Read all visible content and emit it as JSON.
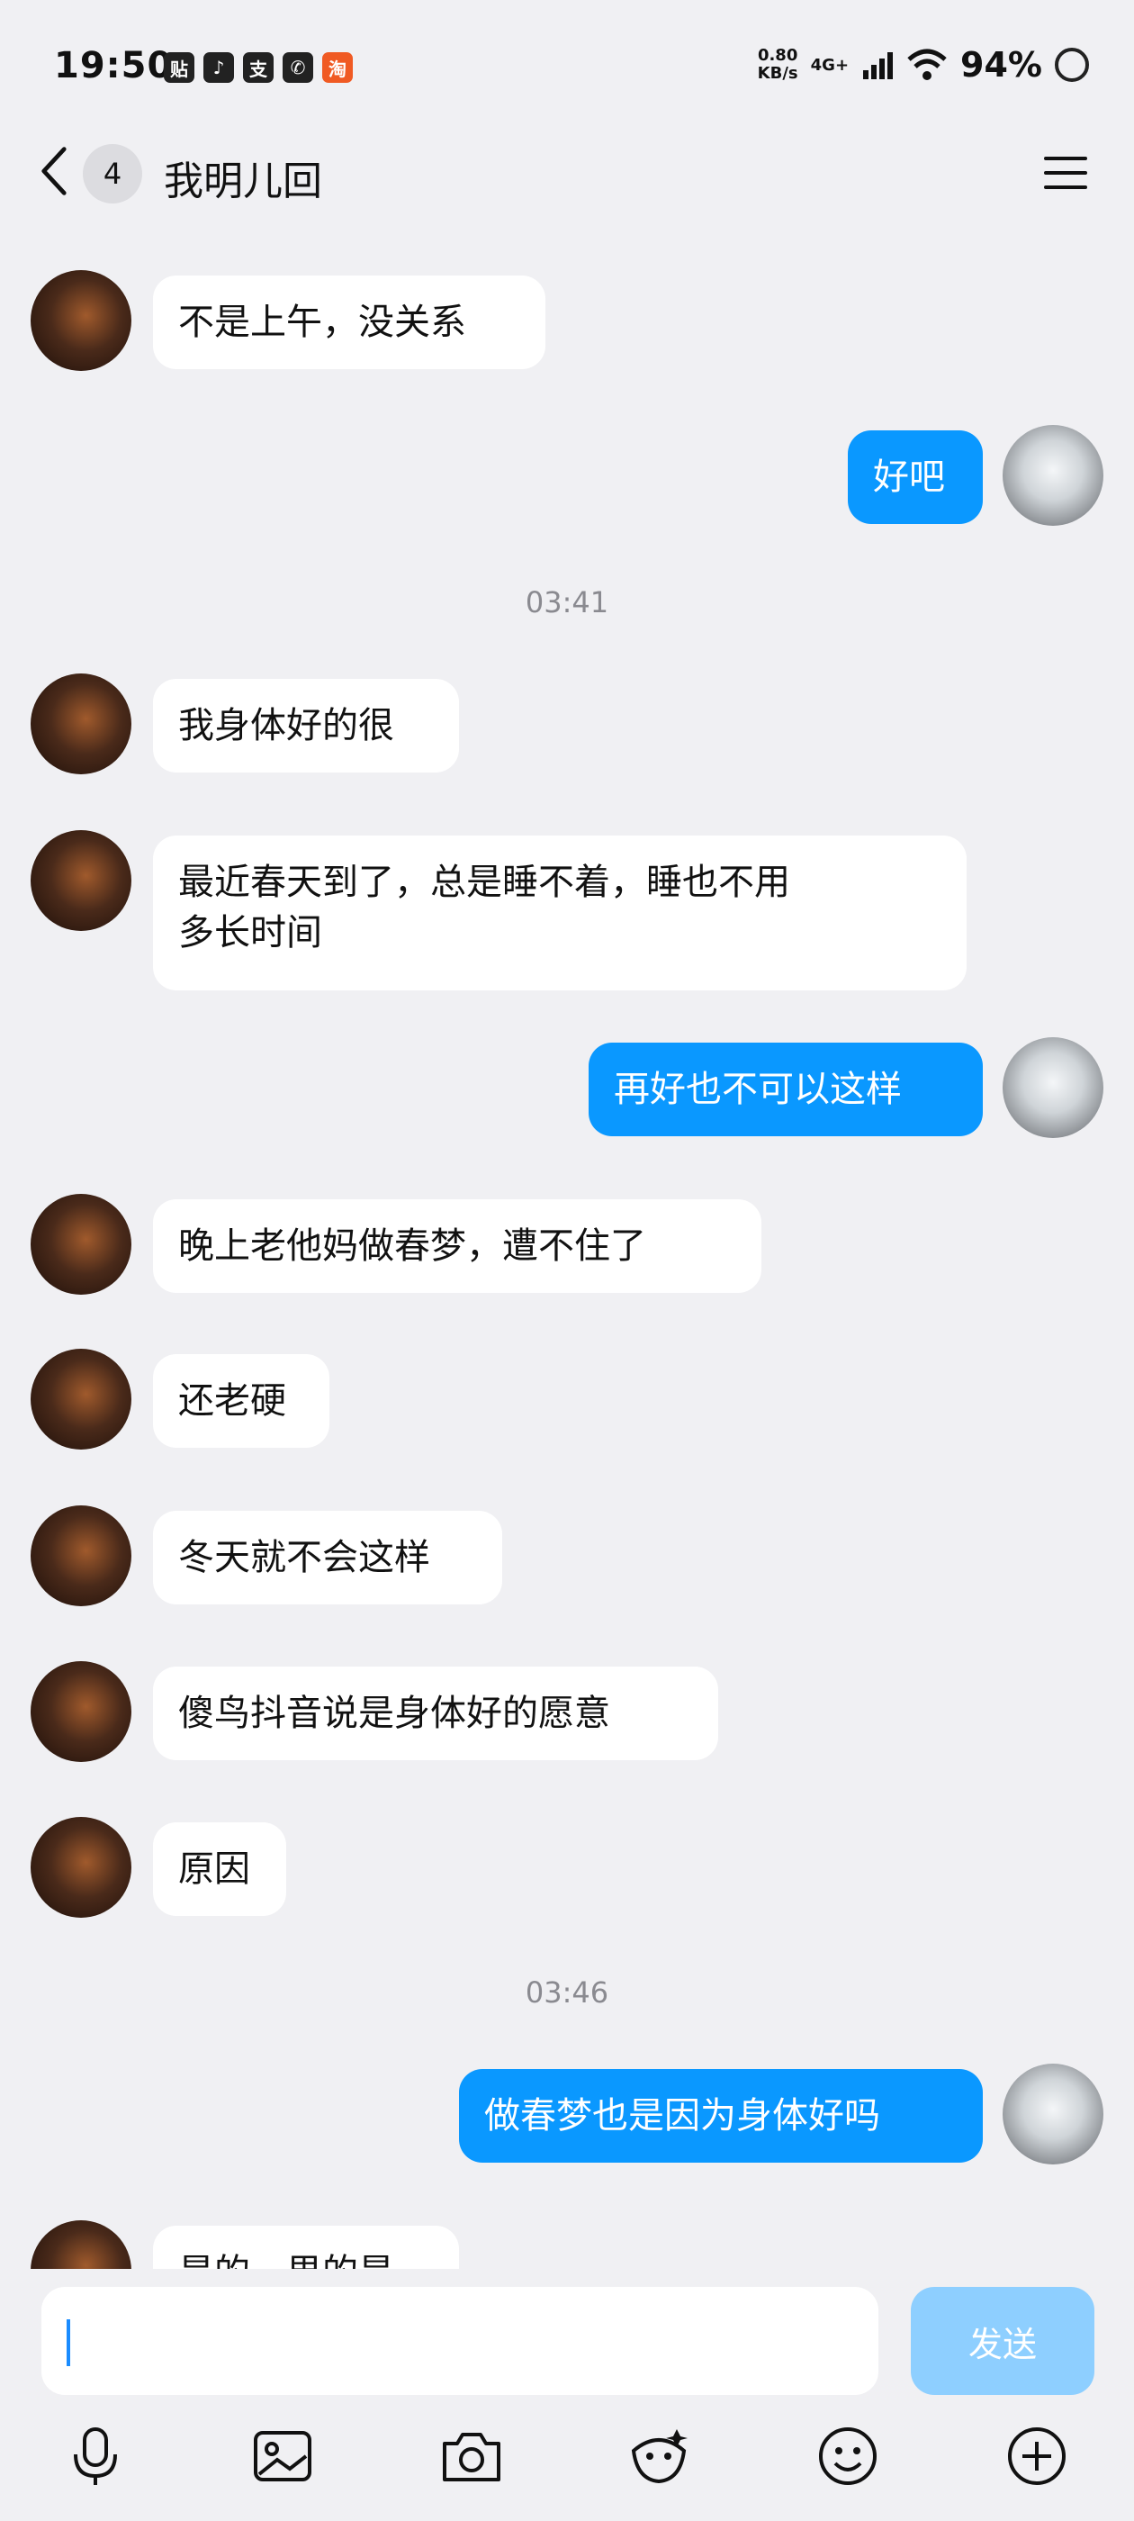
{
  "status": {
    "time": "19:50",
    "speed_value": "0.80",
    "speed_unit": "KB/s",
    "network": "4G+",
    "battery": "94%"
  },
  "header": {
    "unread": "4",
    "title": "我明儿回"
  },
  "messages": [
    {
      "text": "不是上午，没关系"
    },
    {
      "text": "好吧"
    },
    {
      "text": "03:41"
    },
    {
      "text": "我身体好的很"
    },
    {
      "text": "最近春天到了，总是睡不着，睡也不用"
    },
    {
      "text": "多长时间"
    },
    {
      "text": "再好也不可以这样"
    },
    {
      "text": "晚上老他妈做春梦，遭不住了"
    },
    {
      "text": "还老硬"
    },
    {
      "text": "冬天就不会这样"
    },
    {
      "text": "傻鸟抖音说是身体好的愿意"
    },
    {
      "text": "原因"
    },
    {
      "text": "03:46"
    },
    {
      "text": "做春梦也是因为身体好吗"
    },
    {
      "text": "是的，男的是"
    }
  ],
  "composer": {
    "send_label": "发送"
  },
  "toolbar": {
    "icons": [
      "mic-icon",
      "image-icon",
      "camera-icon",
      "sticker-icon",
      "emoji-icon",
      "plus-icon"
    ]
  },
  "colors": {
    "sent_bubble": "#0a98ff",
    "received_bubble": "#ffffff",
    "send_button_disabled": "#8ecfff",
    "background": "#f0f0f3"
  }
}
